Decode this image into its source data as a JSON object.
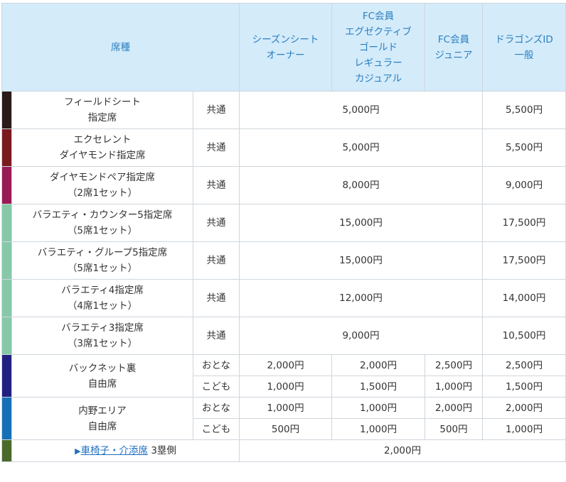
{
  "colors": {
    "header_bg": "#d4ebfa",
    "header_text": "#2a7fc0",
    "border": "#cfd6dc",
    "field_seat": "#2a1a18",
    "excellent": "#7a1a1f",
    "diamond_pair": "#9a1a55",
    "variety": "#86c9a8",
    "backnet": "#1f2080",
    "infield": "#1670b8",
    "wheelchair": "#4a6a2c",
    "link": "#1f6fc0"
  },
  "header": {
    "seat_type": "席種",
    "season": [
      "シーズンシート",
      "オーナー"
    ],
    "fc": [
      "FC会員",
      "エグゼクティブ",
      "ゴールド",
      "レギュラー",
      "カジュアル"
    ],
    "fc_junior": [
      "FC会員",
      "ジュニア"
    ],
    "dragons_id": [
      "ドラゴンズID",
      "一般"
    ]
  },
  "rows": [
    {
      "name": [
        "フィールドシート",
        "指定席"
      ],
      "type": "共通",
      "member": "5,000円",
      "general": "5,500円"
    },
    {
      "name": [
        "エクセレント",
        "ダイヤモンド指定席"
      ],
      "type": "共通",
      "member": "5,000円",
      "general": "5,500円"
    },
    {
      "name": [
        "ダイヤモンドペア指定席",
        "（2席1セット）"
      ],
      "type": "共通",
      "member": "8,000円",
      "general": "9,000円"
    },
    {
      "name": [
        "バラエティ・カウンター5指定席",
        "（5席1セット）"
      ],
      "type": "共通",
      "member": "15,000円",
      "general": "17,500円"
    },
    {
      "name": [
        "バラエティ・グループ5指定席",
        "（5席1セット）"
      ],
      "type": "共通",
      "member": "15,000円",
      "general": "17,500円"
    },
    {
      "name": [
        "バラエティ4指定席",
        "（4席1セット）"
      ],
      "type": "共通",
      "member": "12,000円",
      "general": "14,000円"
    },
    {
      "name": [
        "バラエティ3指定席",
        "（3席1セット）"
      ],
      "type": "共通",
      "member": "9,000円",
      "general": "10,500円"
    }
  ],
  "backnet": {
    "name": [
      "バックネット裏",
      "自由席"
    ],
    "adult": {
      "label": "おとな",
      "season": "2,000円",
      "fc": "2,000円",
      "junior": "2,500円",
      "general": "2,500円"
    },
    "child": {
      "label": "こども",
      "season": "1,000円",
      "fc": "1,500円",
      "junior": "1,000円",
      "general": "1,500円"
    }
  },
  "infield": {
    "name": [
      "内野エリア",
      "自由席"
    ],
    "adult": {
      "label": "おとな",
      "season": "1,000円",
      "fc": "1,000円",
      "junior": "2,000円",
      "general": "2,000円"
    },
    "child": {
      "label": "こども",
      "season": "500円",
      "fc": "1,000円",
      "junior": "500円",
      "general": "1,000円"
    }
  },
  "wheelchair": {
    "arrow": "▶",
    "link": "車椅子・介添席",
    "note": " 3塁側",
    "price": "2,000円"
  }
}
